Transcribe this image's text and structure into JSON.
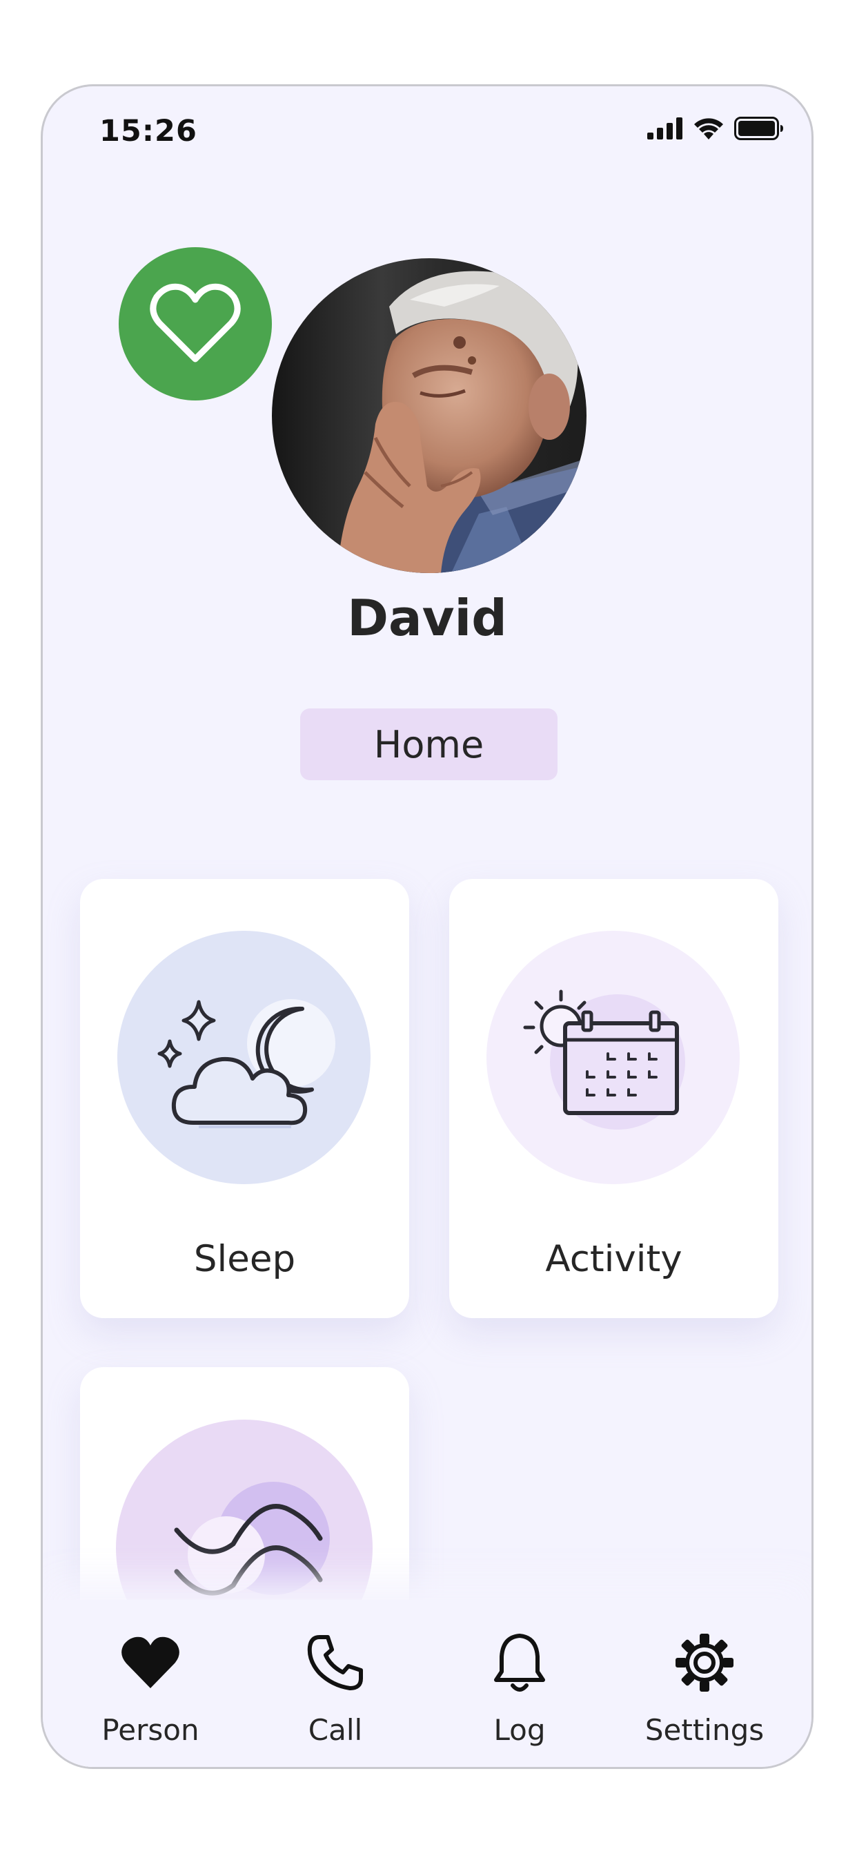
{
  "status_bar": {
    "time": "15:26"
  },
  "profile": {
    "name": "David",
    "location": "Home",
    "status_icon": "heart-icon",
    "status_color": "#4ba54e"
  },
  "tiles": [
    {
      "label": "Sleep",
      "icon": "sleep-icon",
      "circle_color": "#dfe4f6"
    },
    {
      "label": "Activity",
      "icon": "calendar-icon",
      "circle_color": "#f4eefc"
    },
    {
      "label": "",
      "icon": "wave-icon",
      "circle_color": "#e9daf5"
    }
  ],
  "bottom_nav": {
    "items": [
      {
        "label": "Person",
        "icon": "heart-filled-icon"
      },
      {
        "label": "Call",
        "icon": "phone-icon"
      },
      {
        "label": "Log",
        "icon": "bell-icon"
      },
      {
        "label": "Settings",
        "icon": "gear-icon"
      }
    ]
  },
  "colors": {
    "background": "#f4f3fe",
    "tile": "#ffffff",
    "accent_purple": "#e9dcf6",
    "text": "#262626"
  }
}
